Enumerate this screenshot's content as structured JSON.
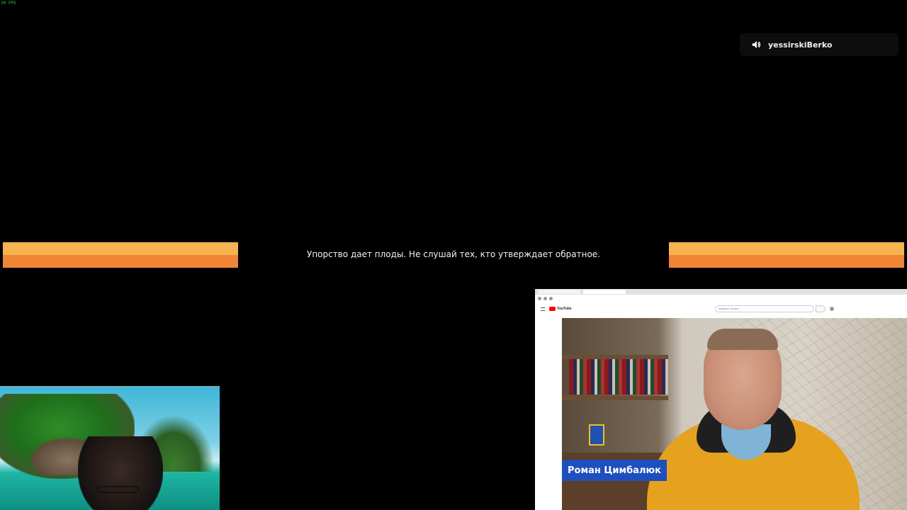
{
  "overlay": {
    "fps_label": "30 FPS",
    "speaker": {
      "icon": "speaker-icon",
      "username": "yessirskiBerko"
    },
    "caption": "Упорство дает плоды. Не слушай тех, кто утверждает обратное.",
    "bar_colors": {
      "top": "#f6b352",
      "bottom": "#ef8535"
    }
  },
  "browser": {
    "brand": "YouTube",
    "search_placeholder": "Введите запрос",
    "video": {
      "name_plate": "Роман Цимбалюк",
      "name_plate_color": "#1e4fbf"
    }
  }
}
